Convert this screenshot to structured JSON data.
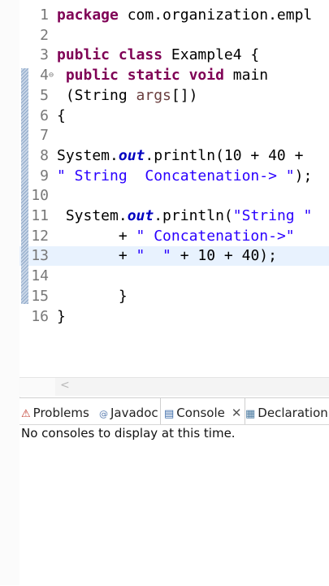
{
  "editor": {
    "lines": [
      {
        "num": "1",
        "parts": [
          {
            "t": "kw",
            "v": "package"
          },
          {
            "t": "n",
            "v": " com.organization.empl"
          }
        ]
      },
      {
        "num": "2",
        "parts": []
      },
      {
        "num": "3",
        "parts": [
          {
            "t": "kw",
            "v": "public"
          },
          {
            "t": "n",
            "v": " "
          },
          {
            "t": "kw",
            "v": "class"
          },
          {
            "t": "n",
            "v": " Example4 {"
          }
        ]
      },
      {
        "num": "4",
        "parts": [
          {
            "t": "n",
            "v": " "
          },
          {
            "t": "kw",
            "v": "public"
          },
          {
            "t": "n",
            "v": " "
          },
          {
            "t": "kw",
            "v": "static"
          },
          {
            "t": "n",
            "v": " "
          },
          {
            "t": "kw",
            "v": "void"
          },
          {
            "t": "n",
            "v": " main"
          }
        ]
      },
      {
        "num": "5",
        "parts": [
          {
            "t": "n",
            "v": " (String "
          },
          {
            "t": "param",
            "v": "args"
          },
          {
            "t": "n",
            "v": "[])"
          }
        ]
      },
      {
        "num": "6",
        "parts": [
          {
            "t": "n",
            "v": "{"
          }
        ]
      },
      {
        "num": "7",
        "parts": []
      },
      {
        "num": "8",
        "parts": [
          {
            "t": "n",
            "v": "System."
          },
          {
            "t": "field",
            "v": "out"
          },
          {
            "t": "n",
            "v": ".println(10 + 40 +"
          }
        ]
      },
      {
        "num": "9",
        "parts": [
          {
            "t": "str",
            "v": "\" String  Concatenation-> \""
          },
          {
            "t": "n",
            "v": ");"
          }
        ]
      },
      {
        "num": "10",
        "parts": []
      },
      {
        "num": "11",
        "parts": [
          {
            "t": "n",
            "v": " System."
          },
          {
            "t": "field",
            "v": "out"
          },
          {
            "t": "n",
            "v": ".println("
          },
          {
            "t": "str",
            "v": "\"String \""
          }
        ]
      },
      {
        "num": "12",
        "parts": [
          {
            "t": "n",
            "v": "       + "
          },
          {
            "t": "str",
            "v": "\" Concatenation->\""
          }
        ]
      },
      {
        "num": "13",
        "parts": [
          {
            "t": "n",
            "v": "       + "
          },
          {
            "t": "str",
            "v": "\"  \""
          },
          {
            "t": "n",
            "v": " + 10 + 40);"
          }
        ]
      },
      {
        "num": "14",
        "parts": []
      },
      {
        "num": "15",
        "parts": [
          {
            "t": "n",
            "v": "       }"
          }
        ]
      },
      {
        "num": "16",
        "parts": [
          {
            "t": "n",
            "v": "}"
          }
        ]
      }
    ],
    "current_line": "13",
    "fold_marker_line": "4",
    "fold_symbol": "⊖"
  },
  "scrollbar": {
    "left_arrow": "<"
  },
  "panel": {
    "tabs": [
      {
        "label": "Problems",
        "icon": "problems-icon",
        "glyph": "⚠"
      },
      {
        "label": "Javadoc",
        "icon": "javadoc-icon",
        "glyph": "@"
      },
      {
        "label": "Console",
        "icon": "console-icon",
        "glyph": "▤",
        "active": true,
        "close": "✕"
      },
      {
        "label": "Declaration",
        "icon": "declaration-icon",
        "glyph": "▦"
      }
    ],
    "console_message": "No consoles to display at this time."
  },
  "colors": {
    "keyword": "#7f0055",
    "string": "#2a00ff",
    "field": "#0000c0",
    "current_line": "#e8f2fe"
  }
}
